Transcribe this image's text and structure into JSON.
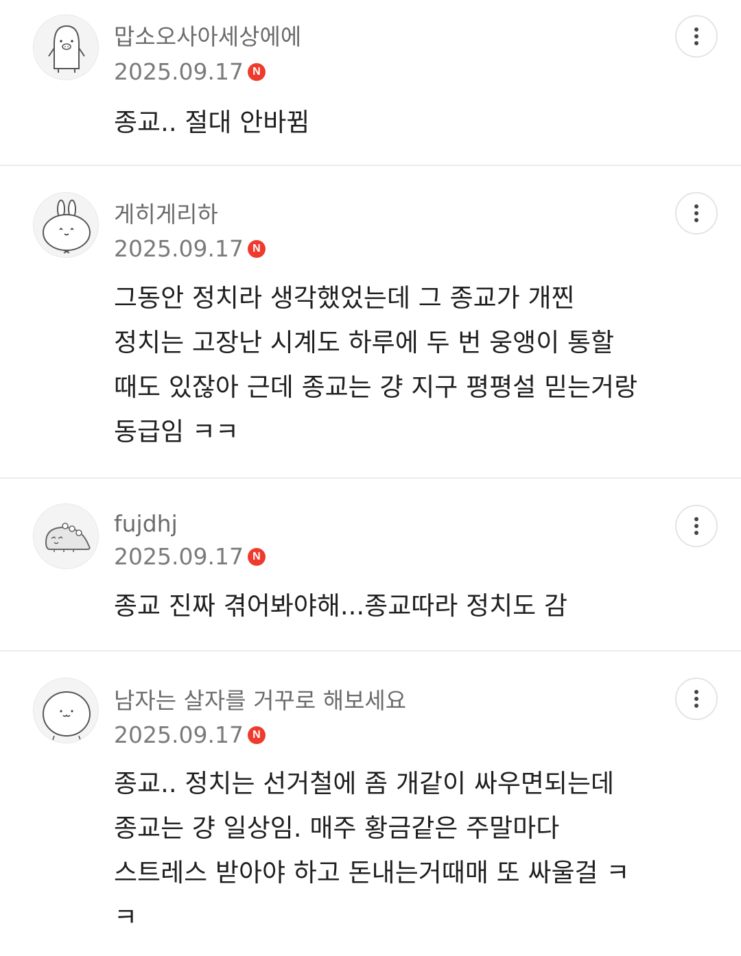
{
  "comments": [
    {
      "nickname": "맙소오사아세상에에",
      "date": "2025.09.17",
      "badge": "N",
      "avatar_icon": "penguin-icon",
      "lines": [
        "종교.. 절대 안바뀜"
      ]
    },
    {
      "nickname": "게히게리하",
      "date": "2025.09.17",
      "badge": "N",
      "avatar_icon": "rabbit-icon",
      "lines": [
        "그동안 정치라 생각했었는데 그 종교가 개찐",
        "정치는 고장난 시계도 하루에 두 번 웅앵이 통할",
        "때도 있잖아 근데 종교는 걍 지구 평평설 믿는거랑",
        "동급임 ㅋㅋ"
      ]
    },
    {
      "nickname": "fujdhj",
      "date": "2025.09.17",
      "badge": "N",
      "avatar_icon": "dinosaur-icon",
      "lines": [
        "종교 진짜 겪어봐야해...종교따라 정치도 감"
      ]
    },
    {
      "nickname": "남자는 살자를 거꾸로 해보세요",
      "date": "2025.09.17",
      "badge": "N",
      "avatar_icon": "round-character-icon",
      "lines": [
        "종교.. 정치는 선거철에 좀 개같이 싸우면되는데",
        "종교는 걍 일상임. 매주 황금같은 주말마다",
        "스트레스 받아야 하고 돈내는거때매 또 싸울걸 ㅋ",
        "ㅋ"
      ]
    }
  ],
  "icons": {
    "more": "more-vertical-icon",
    "new_badge": "new-badge-icon"
  },
  "colors": {
    "badge": "#ef3b2d",
    "divider": "#ececec",
    "meta_text": "#7a7a7a"
  }
}
